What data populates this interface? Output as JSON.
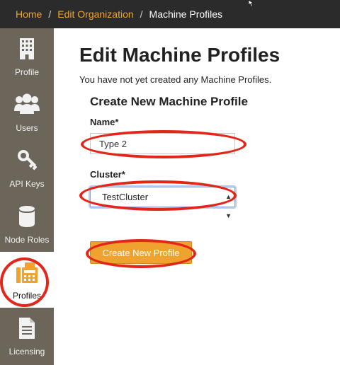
{
  "breadcrumb": {
    "home": "Home",
    "edit_org": "Edit Organization",
    "current": "Machine Profiles",
    "separator": "/"
  },
  "sidebar": {
    "items": [
      {
        "label": "Profile",
        "icon": "building-icon"
      },
      {
        "label": "Users",
        "icon": "users-icon"
      },
      {
        "label": "API Keys",
        "icon": "key-icon"
      },
      {
        "label": "Node Roles",
        "icon": "database-icon"
      },
      {
        "label": "Profiles",
        "icon": "fax-icon",
        "active": true
      },
      {
        "label": "Licensing",
        "icon": "document-icon"
      }
    ]
  },
  "main": {
    "title": "Edit Machine Profiles",
    "empty_message": "You have not yet created any Machine Profiles.",
    "form": {
      "section_title": "Create New Machine Profile",
      "name_label": "Name*",
      "name_value": "Type 2",
      "cluster_label": "Cluster*",
      "cluster_value": "TestCluster",
      "submit_label": "Create New Profile"
    }
  },
  "colors": {
    "accent": "#f0a22e",
    "sidebar": "#6b655a",
    "breadcrumb_bg": "#2b2b2b",
    "highlight": "#e3261a"
  }
}
